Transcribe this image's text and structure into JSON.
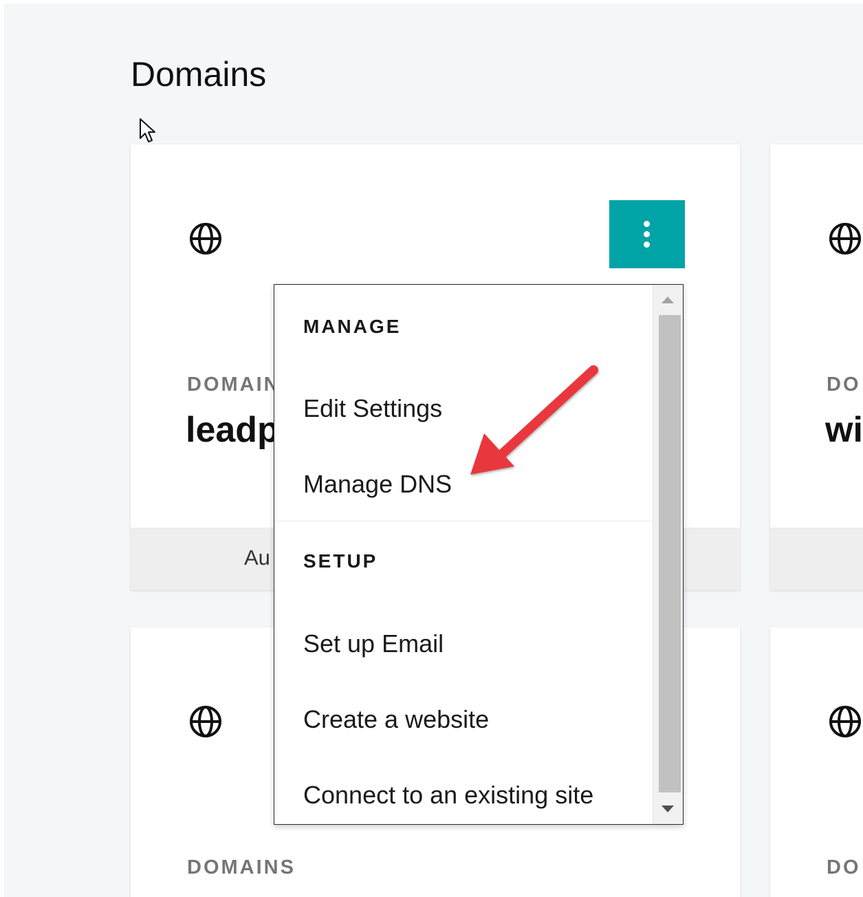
{
  "page": {
    "title": "Domains"
  },
  "cards": [
    {
      "domain_label": "DOMAINS",
      "domain_name": "leadp",
      "footer_text": "Au",
      "menu_button_icon": "vertical-ellipsis-icon"
    },
    {
      "domain_label": "DO",
      "domain_name": "wi"
    },
    {
      "domain_label": "DOMAINS"
    },
    {
      "domain_label": "DO"
    }
  ],
  "dropdown": {
    "sections": [
      {
        "label": "MANAGE",
        "items": [
          "Edit Settings",
          "Manage DNS"
        ]
      },
      {
        "label": "SETUP",
        "items": [
          "Set up Email",
          "Create a website",
          "Connect to an existing site"
        ]
      }
    ]
  },
  "colors": {
    "accent": "#00a4a6",
    "annotation_arrow": "#e8383d",
    "page_background": "#f5f6f8"
  },
  "icons": {
    "card": "globe-icon",
    "cursor": "mouse-pointer-icon",
    "annotation": "red-arrow-icon"
  }
}
